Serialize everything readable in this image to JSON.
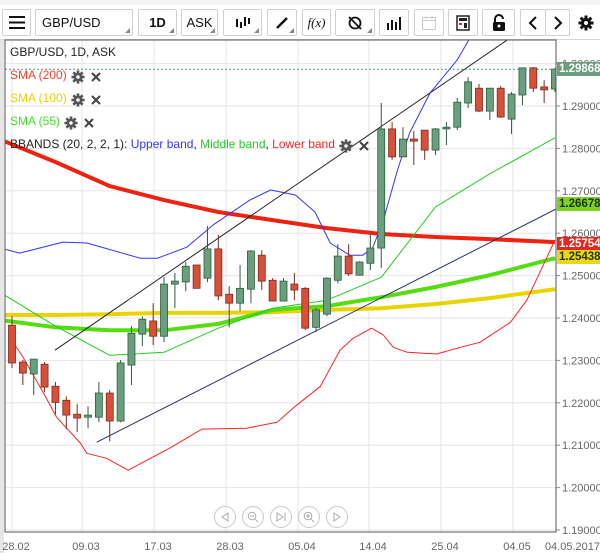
{
  "toolbar": {
    "menu_icon": "hamburger-menu-icon",
    "symbol": "GBP/USD",
    "timeframe": "1D",
    "price_side": "ASK",
    "buttons": [
      "chart-type-icon",
      "pencil-icon",
      "function-icon",
      "indicator-hide-icon",
      "bar-chart-icon",
      "calendar-icon",
      "calculator-icon",
      "lock-icon",
      "chevron-left-icon",
      "chevron-right-icon",
      "gear-icon"
    ],
    "function_label": "f(x)"
  },
  "legend": {
    "title": "GBP/USD, 1D, ASK",
    "indicators": [
      {
        "label": "SMA (200)",
        "color": "#ff3b2f"
      },
      {
        "label": "SMA (100)",
        "color": "#e6d200"
      },
      {
        "label": "SMA (55)",
        "color": "#44dd22"
      }
    ],
    "bbands": {
      "prefix": "BBANDS (20, 2, 2, 1): ",
      "upper": "Upper band",
      "sep1": ", ",
      "middle": "Middle band",
      "sep2": ", ",
      "lower": "Lower band",
      "upper_color": "#3333ff",
      "middle_color": "#22cc22",
      "lower_color": "#ff2222"
    }
  },
  "price_axis": {
    "ticks": [
      "1.30000",
      "1.29000",
      "1.28000",
      "1.27000",
      "1.26000",
      "1.25000",
      "1.24000",
      "1.23000",
      "1.22000",
      "1.21000",
      "1.20000",
      "1.19000"
    ],
    "tick_values": [
      1.3,
      1.29,
      1.28,
      1.27,
      1.26,
      1.25,
      1.24,
      1.23,
      1.22,
      1.21,
      1.2,
      1.19
    ]
  },
  "date_axis": {
    "ticks": [
      "28.02",
      "09.03",
      "17.03",
      "28.03",
      "05.04",
      "14.04",
      "25.04",
      "04.05"
    ],
    "current_date": "04.05.2017"
  },
  "price_labels": [
    {
      "text": "1.29868",
      "value": 1.29868,
      "bg": "#6b9c7c",
      "fg": "#ffffff",
      "name": "current-price-label"
    },
    {
      "text": "1.26678",
      "value": 1.26678,
      "bg": "#7ed321",
      "fg": "#1a3300",
      "name": "trendline-price-label"
    },
    {
      "text": "1.25754",
      "value": 1.25754,
      "bg": "#e8261c",
      "fg": "#ffffff",
      "name": "sma200-price-label"
    },
    {
      "text": "1.25438",
      "value": 1.25438,
      "bg": "#e8d81a",
      "fg": "#333300",
      "name": "sma100-price-label"
    }
  ],
  "nav_buttons": [
    "scroll-left-icon",
    "zoom-out-icon",
    "go-to-end-icon",
    "zoom-in-icon",
    "scroll-right-icon"
  ],
  "chart_data": {
    "type": "candlestick",
    "symbol": "GBP/USD",
    "timeframe": "1D",
    "ylim": [
      1.19,
      1.3
    ],
    "grid": true,
    "colors": {
      "up": "#6a9f7e",
      "up_border": "#2e5b3e",
      "down": "#d9503a",
      "down_border": "#7a2a1e"
    },
    "candles_ohlc": [
      [
        1.2383,
        1.2404,
        1.2282,
        1.2294
      ],
      [
        1.2296,
        1.2301,
        1.2242,
        1.227
      ],
      [
        1.2268,
        1.2303,
        1.2218,
        1.2303
      ],
      [
        1.2291,
        1.2296,
        1.2225,
        1.2237
      ],
      [
        1.2239,
        1.2249,
        1.2173,
        1.2201
      ],
      [
        1.2206,
        1.2215,
        1.2138,
        1.2171
      ],
      [
        1.2173,
        1.2197,
        1.2131,
        1.2164
      ],
      [
        1.2166,
        1.2192,
        1.214,
        1.2171
      ],
      [
        1.2166,
        1.2249,
        1.2154,
        1.2223
      ],
      [
        1.2223,
        1.223,
        1.2109,
        1.2157
      ],
      [
        1.2157,
        1.2301,
        1.2154,
        1.2294
      ],
      [
        1.2289,
        1.2381,
        1.2242,
        1.2364
      ],
      [
        1.2362,
        1.2404,
        1.2334,
        1.2397
      ],
      [
        1.2393,
        1.2435,
        1.2336,
        1.2357
      ],
      [
        1.2357,
        1.2496,
        1.2343,
        1.248
      ],
      [
        1.248,
        1.2506,
        1.2423,
        1.2487
      ],
      [
        1.2485,
        1.2532,
        1.2463,
        1.2522
      ],
      [
        1.2525,
        1.2525,
        1.247,
        1.247
      ],
      [
        1.2494,
        1.2617,
        1.2485,
        1.2563
      ],
      [
        1.2563,
        1.2596,
        1.2442,
        1.2452
      ],
      [
        1.2456,
        1.2475,
        1.2378,
        1.2435
      ],
      [
        1.2435,
        1.2525,
        1.2416,
        1.247
      ],
      [
        1.2468,
        1.256,
        1.2435,
        1.2558
      ],
      [
        1.2548,
        1.256,
        1.2466,
        1.2487
      ],
      [
        1.2489,
        1.2494,
        1.244,
        1.244
      ],
      [
        1.244,
        1.2494,
        1.244,
        1.2487
      ],
      [
        1.248,
        1.2506,
        1.2442,
        1.2466
      ],
      [
        1.247,
        1.2473,
        1.2371,
        1.2376
      ],
      [
        1.2378,
        1.2423,
        1.2367,
        1.2419
      ],
      [
        1.2409,
        1.2496,
        1.2404,
        1.2494
      ],
      [
        1.2489,
        1.2574,
        1.2482,
        1.2546
      ],
      [
        1.2546,
        1.2574,
        1.2499,
        1.2504
      ],
      [
        1.2501,
        1.2534,
        1.2501,
        1.2532
      ],
      [
        1.2529,
        1.2596,
        1.2513,
        1.2565
      ],
      [
        1.2565,
        1.2907,
        1.2518,
        1.2846
      ],
      [
        1.2846,
        1.2862,
        1.2773,
        1.278
      ],
      [
        1.278,
        1.285,
        1.278,
        1.2822
      ],
      [
        1.2822,
        1.2841,
        1.2761,
        1.2817
      ],
      [
        1.2843,
        1.2843,
        1.2773,
        1.2796
      ],
      [
        1.2796,
        1.2848,
        1.2784,
        1.2846
      ],
      [
        1.2846,
        1.2862,
        1.2808,
        1.285
      ],
      [
        1.285,
        1.2919,
        1.2843,
        1.2909
      ],
      [
        1.2907,
        1.2968,
        1.2895,
        1.2957
      ],
      [
        1.2942,
        1.2952,
        1.2886,
        1.2888
      ],
      [
        1.2888,
        1.2942,
        1.2867,
        1.2942
      ],
      [
        1.2942,
        1.2947,
        1.2872,
        1.2874
      ],
      [
        1.2869,
        1.2933,
        1.2834,
        1.2928
      ],
      [
        1.2926,
        1.299,
        1.2902,
        1.299
      ],
      [
        1.299,
        1.2992,
        1.2933,
        1.2942
      ],
      [
        1.2945,
        1.2961,
        1.2907,
        1.2938
      ],
      [
        1.294,
        1.299,
        1.2933,
        1.2987
      ]
    ],
    "current_price": 1.29868,
    "overlays": [
      {
        "name": "sma200-line",
        "color": "#ee2211",
        "width": 4,
        "points": [
          [
            0,
            1.282
          ],
          [
            5,
            1.2768
          ],
          [
            10,
            1.2711
          ],
          [
            15,
            1.2678
          ],
          [
            20,
            1.265
          ],
          [
            25,
            1.2631
          ],
          [
            30,
            1.2612
          ],
          [
            35,
            1.2598
          ],
          [
            40,
            1.2591
          ],
          [
            45,
            1.2586
          ],
          [
            51,
            1.2579
          ]
        ]
      },
      {
        "name": "sma100-line",
        "color": "#e8d400",
        "width": 4,
        "points": [
          [
            0,
            1.2407
          ],
          [
            5,
            1.2407
          ],
          [
            10,
            1.2409
          ],
          [
            15,
            1.2412
          ],
          [
            20,
            1.2412
          ],
          [
            25,
            1.2414
          ],
          [
            30,
            1.2419
          ],
          [
            35,
            1.2423
          ],
          [
            40,
            1.2433
          ],
          [
            45,
            1.2447
          ],
          [
            51,
            1.2468
          ]
        ]
      },
      {
        "name": "sma55-line",
        "color": "#55dd11",
        "width": 4,
        "points": [
          [
            0,
            1.2395
          ],
          [
            5,
            1.2378
          ],
          [
            10,
            1.2371
          ],
          [
            15,
            1.2371
          ],
          [
            20,
            1.2386
          ],
          [
            25,
            1.2419
          ],
          [
            30,
            1.2428
          ],
          [
            35,
            1.2449
          ],
          [
            40,
            1.2473
          ],
          [
            45,
            1.2501
          ],
          [
            51,
            1.2541
          ]
        ]
      },
      {
        "name": "bb-middle-band-line",
        "color": "#22cc22",
        "width": 1,
        "points": [
          [
            0,
            1.2459
          ],
          [
            5,
            1.2381
          ],
          [
            10,
            1.2312
          ],
          [
            15,
            1.2319
          ],
          [
            20,
            1.2376
          ],
          [
            25,
            1.2423
          ],
          [
            30,
            1.2442
          ],
          [
            35,
            1.2496
          ],
          [
            40,
            1.2662
          ],
          [
            45,
            1.274
          ],
          [
            51,
            1.2825
          ]
        ]
      },
      {
        "name": "bb-upper-band-line",
        "color": "#3333ff",
        "width": 1,
        "points": [
          [
            -0.1,
            1.2565
          ],
          [
            1.7,
            1.2553
          ],
          [
            5.7,
            1.2579
          ],
          [
            7.9,
            1.2577
          ],
          [
            12.8,
            1.2541
          ],
          [
            14.4,
            1.2541
          ],
          [
            17.1,
            1.2567
          ],
          [
            19.5,
            1.2619
          ],
          [
            22.9,
            1.2678
          ],
          [
            24.8,
            1.2702
          ],
          [
            27.1,
            1.269
          ],
          [
            28.9,
            1.265
          ],
          [
            30.3,
            1.2577
          ],
          [
            32.1,
            1.2548
          ],
          [
            33.3,
            1.2548
          ],
          [
            34.2,
            1.2565
          ],
          [
            35.2,
            1.2631
          ],
          [
            36.5,
            1.2749
          ],
          [
            37.6,
            1.2836
          ],
          [
            39.5,
            1.2931
          ],
          [
            42.0,
            1.3009
          ],
          [
            43.6,
            1.3079
          ]
        ]
      },
      {
        "name": "bb-lower-band-line",
        "color": "#ff2222",
        "width": 1,
        "points": [
          [
            0.8,
            1.2355
          ],
          [
            2.0,
            1.2308
          ],
          [
            3.9,
            1.2223
          ],
          [
            5.1,
            1.2166
          ],
          [
            7.3,
            1.2105
          ],
          [
            7.9,
            1.2081
          ],
          [
            9.7,
            1.2069
          ],
          [
            11.7,
            1.2041
          ],
          [
            15.5,
            1.2093
          ],
          [
            18.5,
            1.2138
          ],
          [
            22.6,
            1.214
          ],
          [
            25.4,
            1.2154
          ],
          [
            27.2,
            1.2194
          ],
          [
            29.4,
            1.2239
          ],
          [
            31.2,
            1.2324
          ],
          [
            32.4,
            1.2352
          ],
          [
            34.1,
            1.2376
          ],
          [
            35.2,
            1.236
          ],
          [
            36.1,
            1.2331
          ],
          [
            37.4,
            1.2319
          ],
          [
            40.1,
            1.2315
          ],
          [
            42.3,
            1.2331
          ],
          [
            44.1,
            1.2343
          ],
          [
            46.9,
            1.239
          ],
          [
            48.4,
            1.2442
          ],
          [
            51.0,
            1.2584
          ]
        ]
      },
      {
        "name": "upper-trendline",
        "color": "#222222",
        "width": 1,
        "points": [
          [
            4.96,
            1.2324
          ],
          [
            47.3,
            1.3068
          ]
        ]
      },
      {
        "name": "lower-trendline",
        "color": "#2a2f66",
        "width": 1,
        "points": [
          [
            8.8,
            1.2107
          ],
          [
            51.1,
            1.2657
          ]
        ]
      }
    ]
  }
}
